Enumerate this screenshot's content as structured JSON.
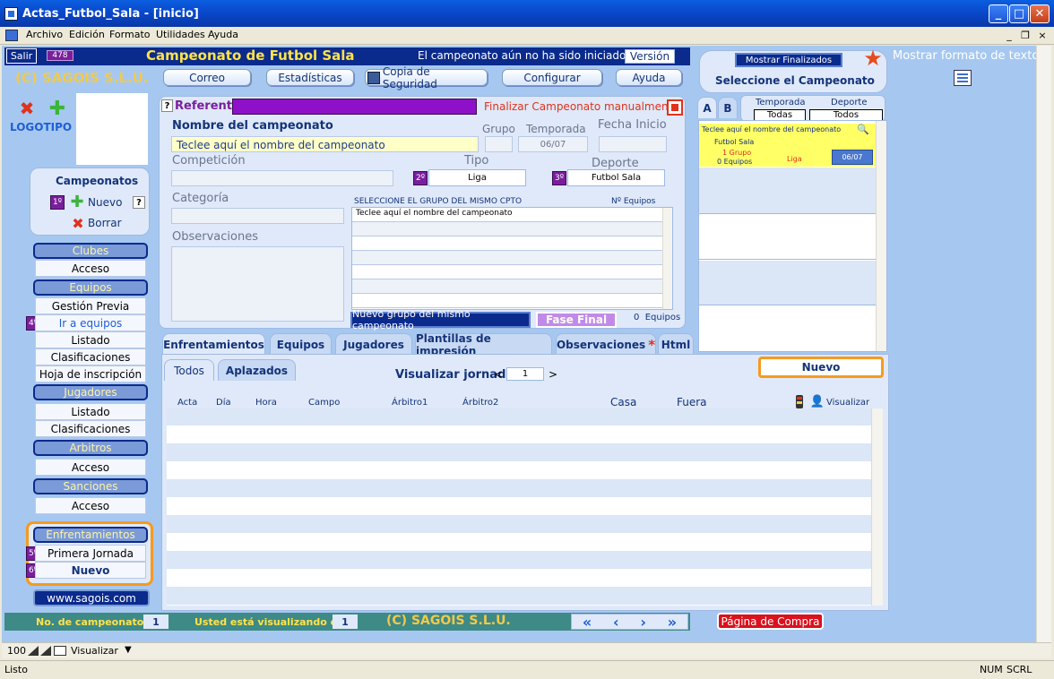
{
  "window": {
    "title": "Actas_Futbol_Sala - [inicio]",
    "min": "_",
    "max": "□",
    "close": "✕"
  },
  "menu": [
    "Archivo",
    "Edición",
    "Formato",
    "Utilidades",
    "Ayuda"
  ],
  "mdi": {
    "min": "_",
    "restore": "❐",
    "close": "×"
  },
  "header": {
    "salir": "Salir",
    "badge": "478",
    "app_title": "Campeonato de Futbol Sala",
    "status": "El campeonato aún no ha sido iniciado",
    "version": "Versión",
    "company": "(C) SAGOIS S.L.U.",
    "buttons": {
      "correo": "Correo",
      "estadisticas": "Estadísticas",
      "copia": "Copia de Seguridad",
      "configurar": "Configurar",
      "ayuda": "Ayuda"
    }
  },
  "top_right": {
    "mostrar_finalizados": "Mostrar Finalizados",
    "seleccione": "Seleccione el Campeonato",
    "mostrar_formato": "Mostrar formato de texto"
  },
  "logo": {
    "label": "LOGOTIPO"
  },
  "campeonatos": {
    "title": "Campeonatos",
    "badge": "1º",
    "nuevo": "Nuevo",
    "help": "?",
    "borrar": "Borrar"
  },
  "sidebar": {
    "clubes": "Clubes",
    "clubes_acceso": "Acceso",
    "equipos": "Equipos",
    "gestion_previa": "Gestión Previa",
    "badge4": "4º",
    "ir_equipos": "Ir a equipos",
    "equipos_listado": "Listado",
    "equipos_clasif": "Clasificaciones",
    "hoja": "Hoja de inscripción",
    "jugadores": "Jugadores",
    "jug_listado": "Listado",
    "jug_clasif": "Clasificaciones",
    "arbitros": "Arbitros",
    "arb_acceso": "Acceso",
    "sanciones": "Sanciones",
    "san_acceso": "Acceso",
    "enfrentamientos": "Enfrentamientos",
    "badge5": "5º",
    "primera_jornada": "Primera Jornada",
    "badge6": "6º",
    "nuevo": "Nuevo",
    "web": "www.sagois.com"
  },
  "form": {
    "help": "?",
    "referente": "Referente",
    "finalizar": "Finalizar Campeonato manualmente",
    "nombre_label": "Nombre del campeonato",
    "nombre_value": "Teclee aquí el nombre del campeonato",
    "grupo_label": "Grupo",
    "temporada_label": "Temporada",
    "temporada_value": "06/07",
    "fecha_label": "Fecha Inicio",
    "competicion_label": "Competición",
    "tipo_label": "Tipo",
    "tipo_badge": "2º",
    "tipo_value": "Liga",
    "deporte_label": "Deporte",
    "deporte_badge": "3º",
    "deporte_value": "Futbol Sala",
    "categoria_label": "Categoría",
    "observaciones_label": "Observaciones",
    "grupo_list_title": "SELECCIONE EL GRUPO DEL MISMO CPTO",
    "n_equipos_label": "Nº Equipos",
    "grupo_list_first": "Teclee aquí el nombre del campeonato",
    "nuevo_grupo": "Nuevo grupo del mismo campeonato",
    "fase_final": "Fase Final",
    "equipos_count": "0",
    "equipos_word": "Equipos"
  },
  "selector": {
    "tab_a": "A",
    "tab_b": "B",
    "temporada": "Temporada",
    "temporada_val": "Todas",
    "deporte": "Deporte",
    "deporte_val": "Todos",
    "item": {
      "nombre": "Teclee aquí el nombre del campeonato",
      "deporte": "Futbol Sala",
      "grupo": "1 Grupo",
      "equipos": "0  Equipos",
      "tipo": "Liga",
      "temporada": "06/07"
    }
  },
  "tabs": [
    "Enfrentamientos",
    "Equipos",
    "Jugadores",
    "Plantillas de impresión",
    "Observaciones",
    "Html"
  ],
  "obs_star": "*",
  "subtabs": [
    "Todos",
    "Aplazados"
  ],
  "jornada": {
    "label": "Visualizar jornada",
    "lt": "<",
    "value": "1",
    "gt": ">"
  },
  "nuevo_btn": "Nuevo",
  "columns": {
    "acta": "Acta",
    "dia": "Día",
    "hora": "Hora",
    "campo": "Campo",
    "arbitro1": "Árbitro1",
    "arbitro2": "Árbitro2",
    "casa": "Casa",
    "fuera": "Fuera",
    "visualizar": "Visualizar"
  },
  "footer": {
    "no_camp_label": "No. de campeonatos",
    "no_camp_value": "1",
    "visual_label": "Usted está visualizando el",
    "visual_value": "1",
    "company": "(C) SAGOIS S.L.U.",
    "pagina_compra": "Página de Compra"
  },
  "hbar": {
    "zoom": "100",
    "view": "Visualizar"
  },
  "status": {
    "text": "Listo",
    "num": "NUM",
    "scrl": "SCRL"
  }
}
